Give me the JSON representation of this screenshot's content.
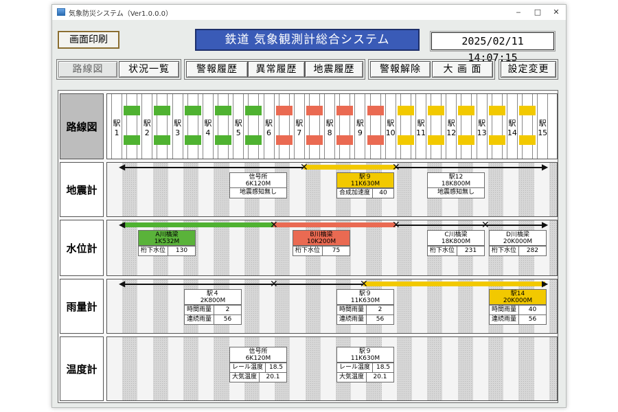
{
  "window": {
    "title": "気象防災システム（Ver1.0.0.0）",
    "minimize": "‒",
    "maximize": "□",
    "close": "✕"
  },
  "header": {
    "print_button": "画面印刷",
    "system_title": "鉄道 気象観測計総合システム",
    "datetime": "2025/02/11　14:07:15"
  },
  "menu": {
    "route_map": "路線図",
    "status_list": "状況一覧",
    "alarm_history": "警報履歴",
    "anomaly_history": "異常履歴",
    "earthquake_history": "地震履歴",
    "alarm_release": "警報解除",
    "big_screen": "大 画 面",
    "settings": "設定変更"
  },
  "rows": {
    "route": "路線図",
    "seismic": "地震計",
    "water": "水位計",
    "rain": "雨量計",
    "temp": "温度計"
  },
  "stations": [
    {
      "line1": "駅",
      "line2": "1"
    },
    {
      "line1": "駅",
      "line2": "2"
    },
    {
      "line1": "駅",
      "line2": "3"
    },
    {
      "line1": "駅",
      "line2": "4"
    },
    {
      "line1": "駅",
      "line2": "5"
    },
    {
      "line1": "駅",
      "line2": "6"
    },
    {
      "line1": "駅",
      "line2": "7"
    },
    {
      "line1": "駅",
      "line2": "8"
    },
    {
      "line1": "駅",
      "line2": "9"
    },
    {
      "line1": "駅",
      "line2": "10"
    },
    {
      "line1": "駅",
      "line2": "11"
    },
    {
      "line1": "駅",
      "line2": "12"
    },
    {
      "line1": "駅",
      "line2": "13"
    },
    {
      "line1": "駅",
      "line2": "14"
    },
    {
      "line1": "駅",
      "line2": "15"
    }
  ],
  "colors": {
    "green": "#4fb231",
    "red": "#ea6a52",
    "yellow": "#f2c900",
    "title_blue": "#3a5bb7"
  },
  "seismic": {
    "card1": {
      "name": "信号所",
      "loc": "6K120M",
      "status": "地震感知無し"
    },
    "card2": {
      "name": "駅９",
      "loc": "11K630M",
      "key": "合成加速度",
      "val": "40"
    },
    "card3": {
      "name": "駅12",
      "loc": "18K800M",
      "status": "地震感知無し"
    }
  },
  "water": {
    "card1": {
      "name": "A川橋梁",
      "loc": "1K532M",
      "key": "桁下水位",
      "val": "130"
    },
    "card2": {
      "name": "B川橋梁",
      "loc": "10K200M",
      "key": "桁下水位",
      "val": "75"
    },
    "card3": {
      "name": "C川橋梁",
      "loc": "18K800M",
      "key": "桁下水位",
      "val": "231"
    },
    "card4": {
      "name": "D川橋梁",
      "loc": "20K000M",
      "key": "桁下水位",
      "val": "282"
    }
  },
  "rain": {
    "card1": {
      "name": "駅４",
      "loc": "2K800M",
      "k1": "時間雨量",
      "v1": "2",
      "k2": "連続雨量",
      "v2": "56"
    },
    "card2": {
      "name": "駅９",
      "loc": "11K630M",
      "k1": "時間雨量",
      "v1": "2",
      "k2": "連続雨量",
      "v2": "56"
    },
    "card3": {
      "name": "駅14",
      "loc": "20K000M",
      "k1": "時間雨量",
      "v1": "40",
      "k2": "連続雨量",
      "v2": "56"
    }
  },
  "temp": {
    "card1": {
      "name": "信号所",
      "loc": "6K120M",
      "k1": "レール温度",
      "v1": "18.5",
      "k2": "大気温度",
      "v2": "20.1"
    },
    "card2": {
      "name": "駅９",
      "loc": "11K630M",
      "k1": "レール温度",
      "v1": "18.5",
      "k2": "大気温度",
      "v2": "20.1"
    }
  }
}
